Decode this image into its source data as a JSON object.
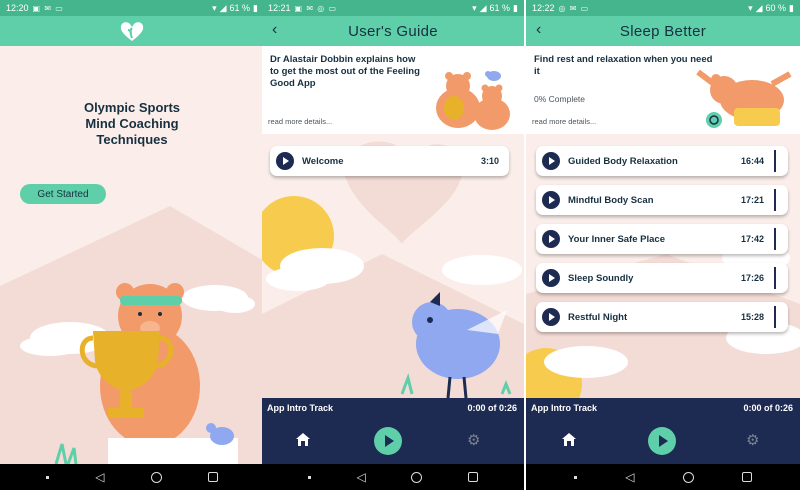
{
  "screens": [
    {
      "status": {
        "time": "12:20",
        "icons": "▣ ✉ ▭",
        "battery": "61 %"
      },
      "heading": "Olympic Sports\nMind Coaching\nTechniques",
      "button": "Get Started"
    },
    {
      "status": {
        "time": "12:21",
        "icons": "▣ ✉ ◎ ▭",
        "battery": "61 %"
      },
      "title": "User's Guide",
      "intro": "Dr Alastair Dobbin explains how to get the most out of the Feeling Good App",
      "read_more": "read more details...",
      "tracks": [
        {
          "name": "Welcome",
          "duration": "3:10"
        }
      ],
      "player": {
        "track": "App Intro Track",
        "time": "0:00 of 0:26"
      }
    },
    {
      "status": {
        "time": "12:22",
        "icons": "◎ ✉ ▭",
        "battery": "60 %"
      },
      "title": "Sleep Better",
      "intro": "Find rest and relaxation when you need it",
      "progress": "0% Complete",
      "read_more": "read more details...",
      "tracks": [
        {
          "name": "Guided Body Relaxation",
          "duration": "16:44"
        },
        {
          "name": "Mindful Body Scan",
          "duration": "17:21"
        },
        {
          "name": "Your Inner Safe Place",
          "duration": "17:42"
        },
        {
          "name": "Sleep Soundly",
          "duration": "17:26"
        },
        {
          "name": "Restful Night",
          "duration": "15:28"
        }
      ],
      "player": {
        "track": "App Intro Track",
        "time": "0:00 of 0:26"
      }
    }
  ],
  "colors": {
    "status_bar": "#45b58e",
    "app_bar": "#5fcfaa",
    "background": "#fbeeea",
    "player": "#1d2a52",
    "text_dark": "#173040"
  },
  "icons": {
    "logo": "heart-leaf-icon",
    "home": "home-icon",
    "play": "play-icon",
    "settings": "gear-icon",
    "back": "back-arrow-icon"
  }
}
